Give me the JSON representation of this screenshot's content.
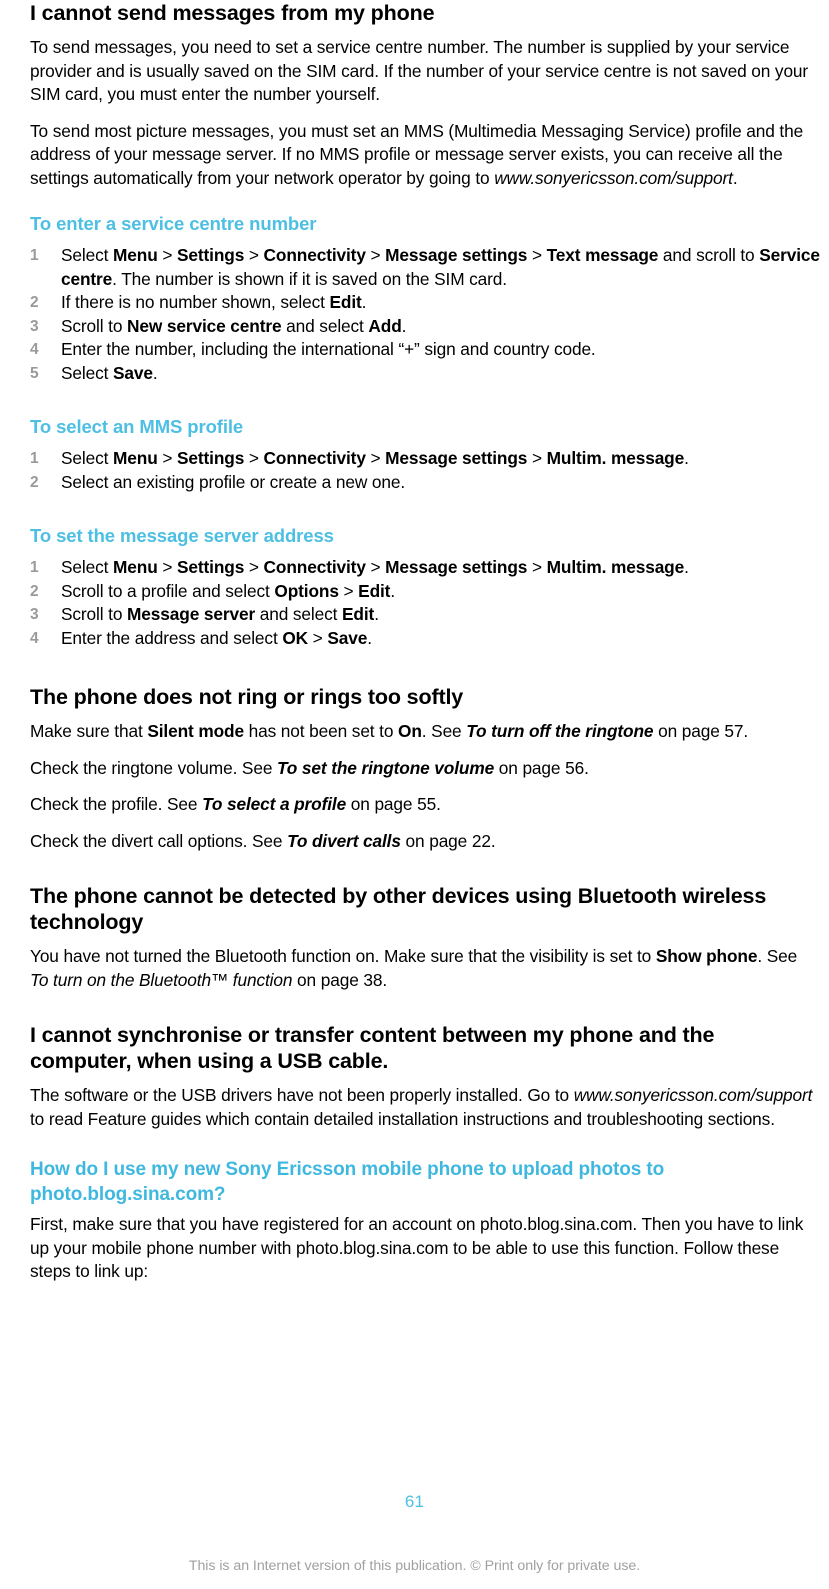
{
  "document": {
    "page_number": "61",
    "footer_note": "This is an Internet version of this publication. © Print only for private use.",
    "accent_color": "#4dbfe3",
    "step_number_color": "#9a9a9a"
  },
  "sections": {
    "send_messages": {
      "title": "I cannot send messages from my phone",
      "paragraph_1": "To send messages, you need to set a service centre number. The number is supplied by your service provider and is usually saved on the SIM card. If the number of your service centre is not saved on your SIM card, you must enter the number yourself.",
      "paragraph_2_part_1": "To send most picture messages, you must set an MMS (Multimedia Messaging Service) profile and the address of your message server. If no MMS profile or message server exists, you can receive all the settings automatically from your network operator by going to ",
      "paragraph_2_url": "www.sonyericsson.com/support",
      "paragraph_2_part_2": "."
    },
    "service_centre_procedure": {
      "title": "To enter a service centre number",
      "steps": [
        {
          "t1": "Select ",
          "b1": "Menu",
          "s1": " > ",
          "b2": "Settings",
          "s2": " > ",
          "b3": "Connectivity",
          "s3": " > ",
          "b4": "Message settings",
          "s4": " > ",
          "b5": "Text message",
          "t2": " and scroll to ",
          "b6": "Service centre",
          "t3": ". The number is shown if it is saved on the SIM card."
        },
        {
          "t1": "If there is no number shown, select ",
          "b1": "Edit",
          "t2": "."
        },
        {
          "t1": "Scroll to ",
          "b1": "New service centre",
          "t2": " and select ",
          "b2": "Add",
          "t3": "."
        },
        {
          "t1": "Enter the number, including the international “+” sign and country code."
        },
        {
          "t1": "Select ",
          "b1": "Save",
          "t2": "."
        }
      ]
    },
    "mms_profile_procedure": {
      "title": "To select an MMS profile",
      "steps": [
        {
          "t1": "Select ",
          "b1": "Menu",
          "s1": " > ",
          "b2": "Settings",
          "s2": " > ",
          "b3": "Connectivity",
          "s3": " > ",
          "b4": "Message settings",
          "s4": " > ",
          "b5": "Multim. message",
          "t2": "."
        },
        {
          "t1": "Select an existing profile or create a new one."
        }
      ]
    },
    "message_server_procedure": {
      "title": "To set the message server address",
      "steps": [
        {
          "t1": "Select ",
          "b1": "Menu",
          "s1": " > ",
          "b2": "Settings",
          "s2": " > ",
          "b3": "Connectivity",
          "s3": " > ",
          "b4": "Message settings",
          "s4": " > ",
          "b5": "Multim. message",
          "t2": "."
        },
        {
          "t1": "Scroll to a profile and select ",
          "b1": "Options",
          "s1": " > ",
          "b2": "Edit",
          "t2": "."
        },
        {
          "t1": "Scroll to ",
          "b1": "Message server",
          "t2": " and select ",
          "b2": "Edit",
          "t3": "."
        },
        {
          "t1": "Enter the address and select ",
          "b1": "OK",
          "s1": " > ",
          "b2": "Save",
          "t2": "."
        }
      ]
    },
    "ringtone": {
      "title": "The phone does not ring or rings too softly",
      "p1_t1": "Make sure that ",
      "p1_b1": "Silent mode",
      "p1_t2": " has not been set to ",
      "p1_b2": "On",
      "p1_t3": ". See ",
      "p1_i1": "To turn off the ringtone",
      "p1_t4": " on page 57.",
      "p2_t1": "Check the ringtone volume. See ",
      "p2_i1": "To set the ringtone volume",
      "p2_t2": " on page 56.",
      "p3_t1": "Check the profile. See ",
      "p3_i1": "To select a profile",
      "p3_t2": " on page 55.",
      "p4_t1": "Check the divert call options. See ",
      "p4_i1": "To divert calls",
      "p4_t2": " on page 22."
    },
    "bluetooth": {
      "title": "The phone cannot be detected by other devices using Bluetooth wireless technology",
      "p1_t1": "You have not turned the Bluetooth function on. Make sure that the visibility is set to ",
      "p1_b1": "Show phone",
      "p1_t2": ". See ",
      "p1_i1": "To turn on the Bluetooth™ function",
      "p1_t3": " on page 38."
    },
    "usb": {
      "title": "I cannot synchronise or transfer content between my phone and the computer, when using a USB cable.",
      "p1_t1": "The software or the USB drivers have not been properly installed. Go to ",
      "p1_i1": "www.sonyericsson.com/support",
      "p1_t2": " to read Feature guides which contain detailed installation instructions and troubleshooting sections."
    },
    "sina_blog": {
      "title": "How do I use my new Sony Ericsson mobile phone to upload photos to photo.blog.sina.com?",
      "paragraph": "First, make sure that you have registered for an account on photo.blog.sina.com. Then you have to link up your mobile phone number with photo.blog.sina.com to be able to use this function. Follow these steps to link up:"
    }
  }
}
